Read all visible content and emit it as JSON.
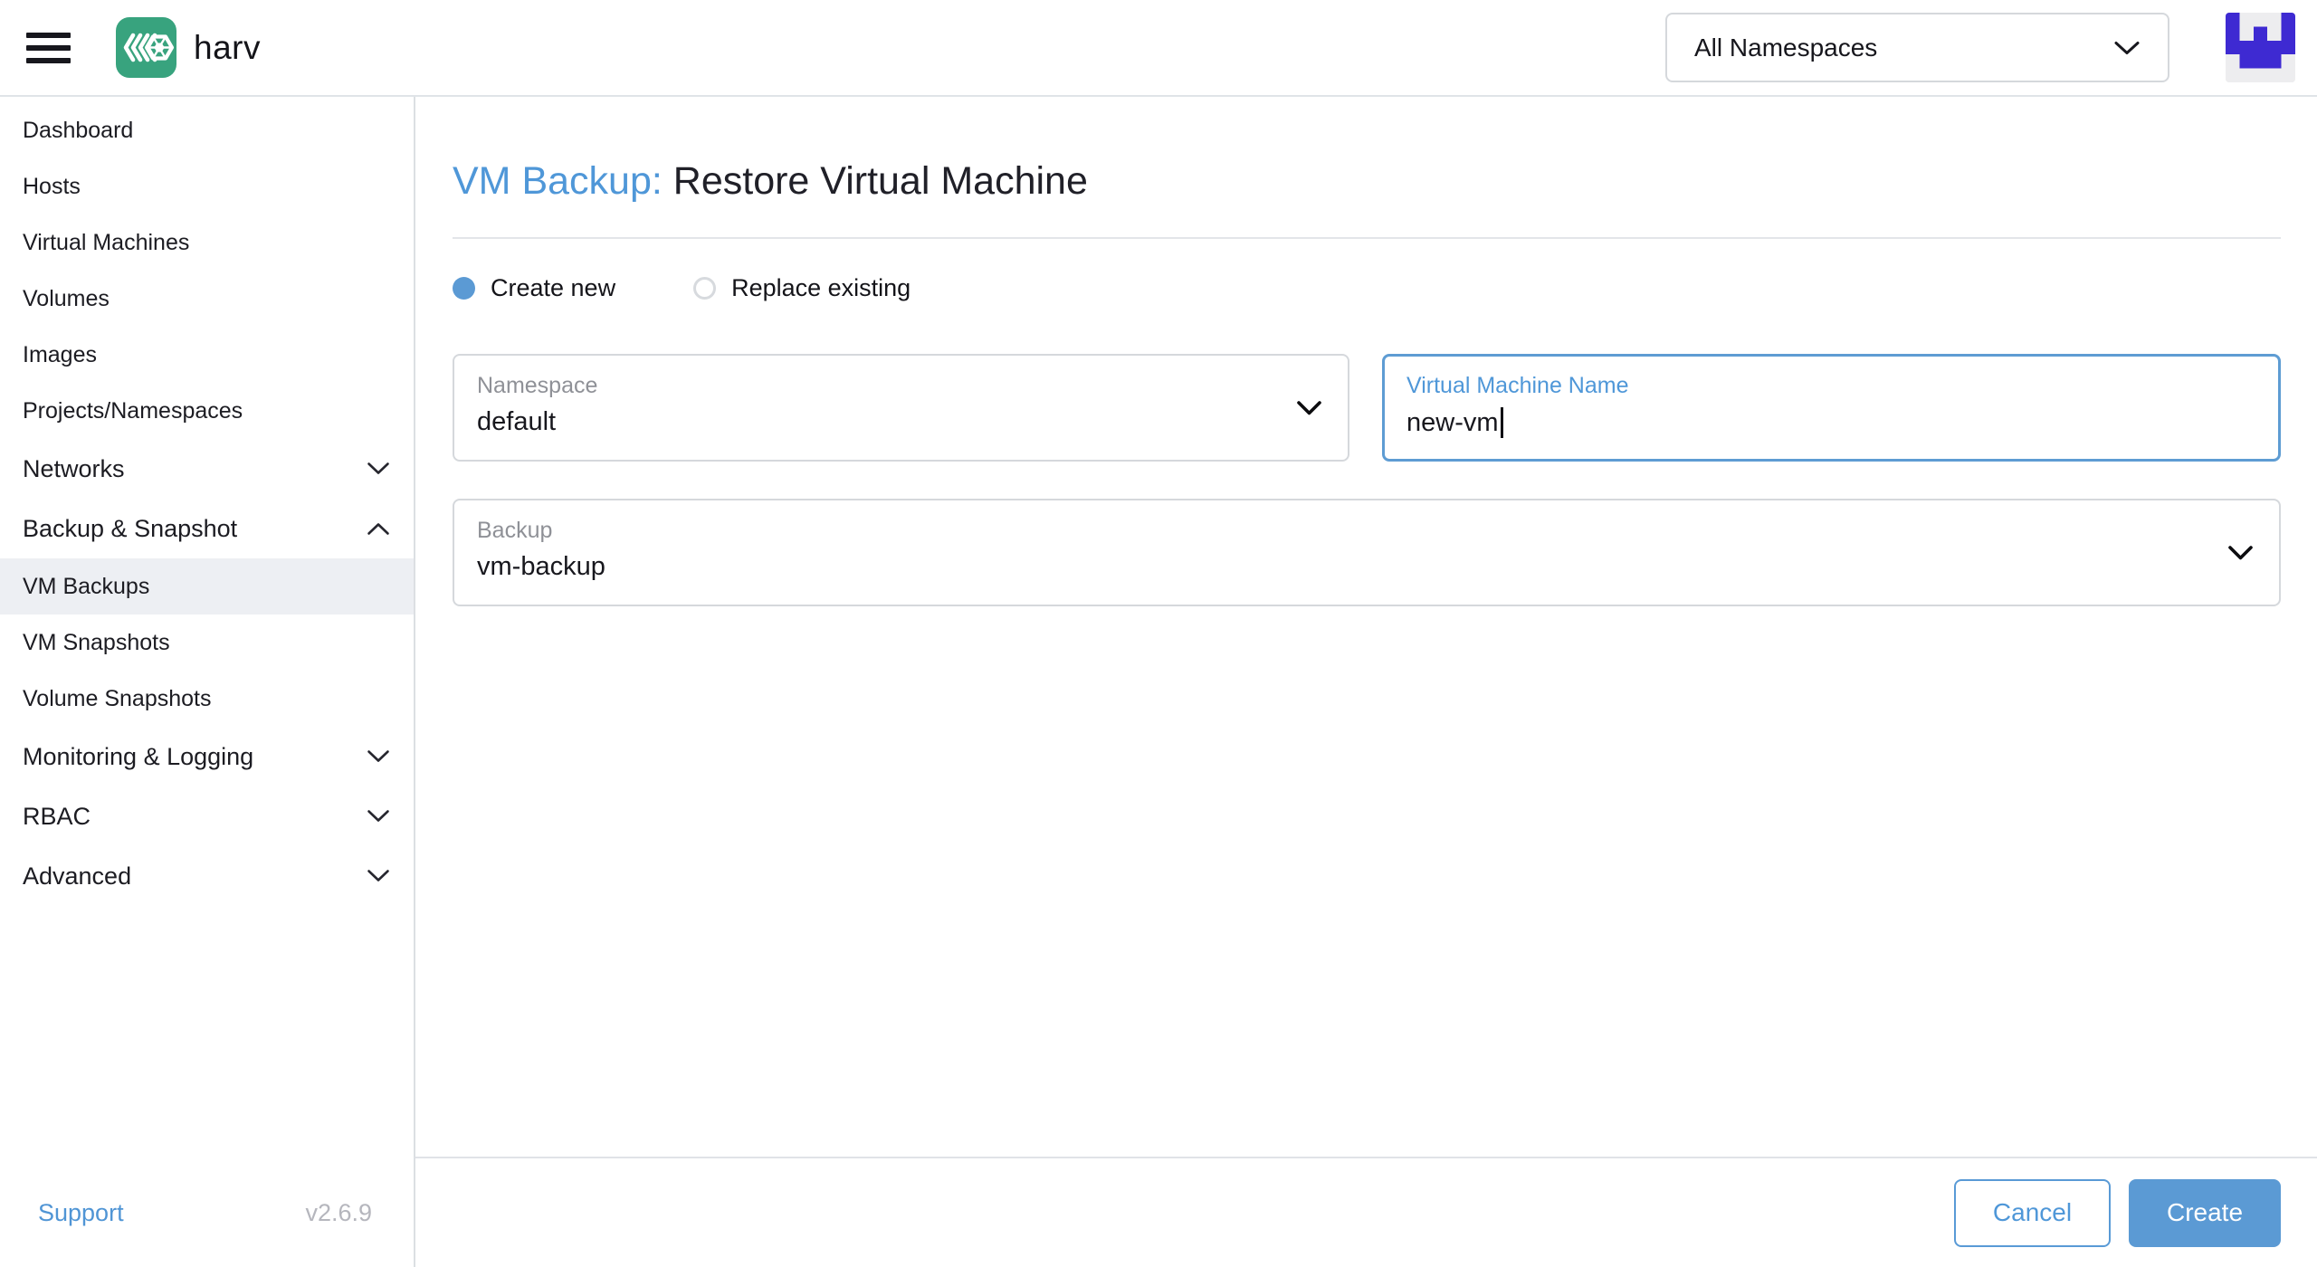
{
  "header": {
    "brand": "harv",
    "namespace_filter": "All Namespaces"
  },
  "sidebar": {
    "items": [
      {
        "label": "Dashboard",
        "type": "item",
        "selected": false
      },
      {
        "label": "Hosts",
        "type": "item",
        "selected": false
      },
      {
        "label": "Virtual Machines",
        "type": "item",
        "selected": false
      },
      {
        "label": "Volumes",
        "type": "item",
        "selected": false
      },
      {
        "label": "Images",
        "type": "item",
        "selected": false
      },
      {
        "label": "Projects/Namespaces",
        "type": "item",
        "selected": false
      },
      {
        "label": "Networks",
        "type": "group",
        "state": "collapsed"
      },
      {
        "label": "Backup & Snapshot",
        "type": "group",
        "state": "expanded"
      },
      {
        "label": "VM Backups",
        "type": "item",
        "selected": true
      },
      {
        "label": "VM Snapshots",
        "type": "item",
        "selected": false
      },
      {
        "label": "Volume Snapshots",
        "type": "item",
        "selected": false
      },
      {
        "label": "Monitoring & Logging",
        "type": "group",
        "state": "collapsed"
      },
      {
        "label": "RBAC",
        "type": "group",
        "state": "collapsed"
      },
      {
        "label": "Advanced",
        "type": "group",
        "state": "collapsed"
      }
    ],
    "footer": {
      "support": "Support",
      "version": "v2.6.9"
    }
  },
  "main": {
    "title_prefix": "VM Backup:",
    "title": "Restore Virtual Machine",
    "radios": [
      {
        "label": "Create new",
        "selected": true
      },
      {
        "label": "Replace existing",
        "selected": false
      }
    ],
    "fields": {
      "namespace": {
        "label": "Namespace",
        "value": "default"
      },
      "vm_name": {
        "label": "Virtual Machine Name",
        "value": "new-vm"
      },
      "backup": {
        "label": "Backup",
        "value": "vm-backup"
      }
    },
    "actions": {
      "cancel": "Cancel",
      "create": "Create"
    }
  },
  "colors": {
    "primary": "#5b9ad4",
    "logo_green": "#38a37e",
    "avatar_purple": "#3e2ad2",
    "selected_row_bg": "#edeff3"
  }
}
